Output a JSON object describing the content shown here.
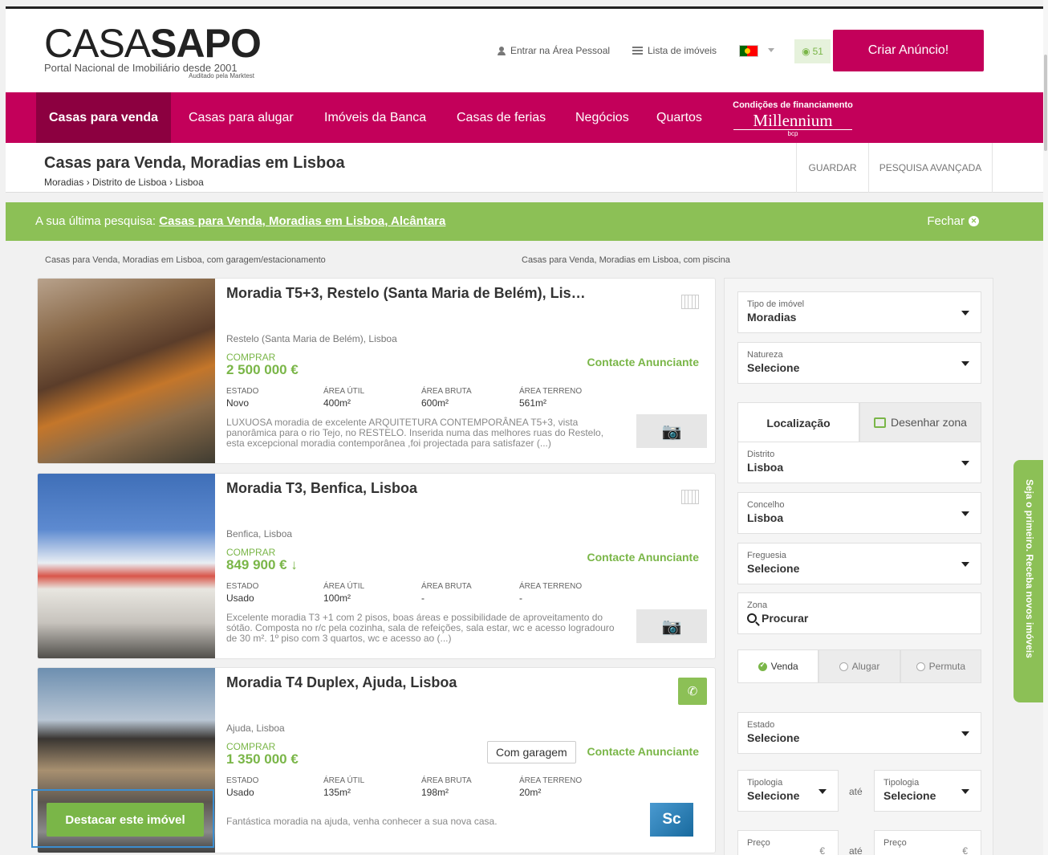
{
  "header": {
    "logo_thin": "CASA",
    "logo_bold": "SAPO",
    "logo_sub": "Portal Nacional de Imobiliário desde 2001",
    "logo_sub2": "Auditado pela Marktest",
    "login": "Entrar na Área Pessoal",
    "list": "Lista de imóveis",
    "fav_count": "51",
    "cta": "Criar Anúncio!",
    "icons": {
      "login": "person-icon",
      "list": "list-icon",
      "flag": "portugal-flag-icon",
      "fav": "eye-icon"
    }
  },
  "nav": {
    "items": [
      "Casas para venda",
      "Casas para alugar",
      "Imóveis da Banca",
      "Casas de ferias",
      "Negócios",
      "Quartos"
    ],
    "finance_label": "Condições de financiamento",
    "finance_brand": "Millennium",
    "finance_brand_sub": "bcp"
  },
  "subheader": {
    "title": "Casas para Venda, Moradias em Lisboa",
    "breadcrumb": "Moradias › Distrito de Lisboa › Lisboa",
    "save": "GUARDAR",
    "advanced": "PESQUISA AVANÇADA"
  },
  "banner": {
    "prefix": "A sua última pesquisa:",
    "link": "Casas para Venda, Moradias em Lisboa, Alcântara",
    "close": "Fechar"
  },
  "related": [
    "Casas para Venda, Moradias em Lisboa, com garagem/estacionamento",
    "Casas para Venda, Moradias em Lisboa, com piscina"
  ],
  "stat_labels": [
    "ESTADO",
    "ÁREA ÚTIL",
    "ÁREA BRUTA",
    "ÁREA TERRENO"
  ],
  "listings": [
    {
      "title": "Moradia T5+3, Restelo (Santa Maria de Belém), Lis…",
      "location": "Restelo (Santa Maria de Belém), Lisboa",
      "mode": "COMPRAR",
      "price": "2 500 000 €",
      "contact": "Contacte Anunciante",
      "estado": "Novo",
      "area_util": "400m²",
      "area_bruta": "600m²",
      "area_terreno": "561m²",
      "description": "LUXUOSA moradia de excelente ARQUITETURA CONTEMPORÂNEA T5+3, vista panorâmica para o rio Tejo, no RESTELO. Inserida numa das melhores ruas do Restelo, esta excepcional moradia contemporânea ,foi projectada para satisfazer (...)"
    },
    {
      "title": "Moradia T3, Benfica, Lisboa",
      "location": "Benfica, Lisboa",
      "mode": "COMPRAR",
      "price": "849 900 € ↓",
      "contact": "Contacte Anunciante",
      "estado": "Usado",
      "area_util": "100m²",
      "area_bruta": "-",
      "area_terreno": "-",
      "description": "Excelente moradia T3 +1 com 2 pisos, boas áreas e possibilidade de aproveitamento do sótão. Composta no r/c pela cozinha, sala de refeições, sala estar, wc e acesso logradouro de 30 m². 1º piso com 3 quartos, wc e acesso ao (...)"
    },
    {
      "title": "Moradia T4 Duplex, Ajuda, Lisboa",
      "location": "Ajuda, Lisboa",
      "mode": "COMPRAR",
      "price": "1 350 000 €",
      "contact": "Contacte Anunciante",
      "tag": "Com garagem",
      "estado": "Usado",
      "area_util": "135m²",
      "area_bruta": "198m²",
      "area_terreno": "20m²",
      "description": "Fantástica moradia na ajuda, venha conhecer a sua nova casa.",
      "agency_logo": "Sc",
      "highlight": "Destacar este imóvel"
    }
  ],
  "sidebar": {
    "tipo_label": "Tipo de imóvel",
    "tipo_value": "Moradias",
    "natureza_label": "Natureza",
    "natureza_value": "Selecione",
    "tab_location": "Localização",
    "tab_draw": "Desenhar zona",
    "distrito_label": "Distrito",
    "distrito_value": "Lisboa",
    "concelho_label": "Concelho",
    "concelho_value": "Lisboa",
    "freguesia_label": "Freguesia",
    "freguesia_value": "Selecione",
    "zona_label": "Zona",
    "zona_value": "Procurar",
    "radios": [
      "Venda",
      "Alugar",
      "Permuta"
    ],
    "estado_label": "Estado",
    "estado_value": "Selecione",
    "tipologia_label": "Tipologia",
    "tipologia_value": "Selecione",
    "ate": "até",
    "preco_label": "Preço",
    "euro": "€"
  },
  "side_tab": "Seja o primeiro. Receba novos imóveis",
  "colors": {
    "brand": "#c3005a",
    "accent": "#7ab648",
    "banner": "#8cc056"
  }
}
